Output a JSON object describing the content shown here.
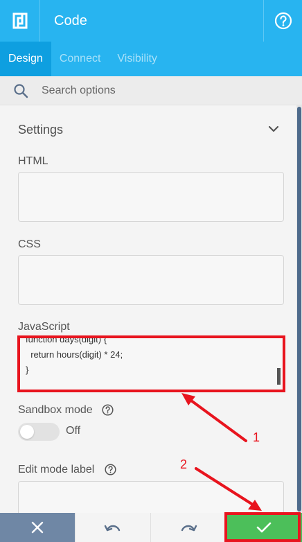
{
  "header": {
    "title": "Code"
  },
  "tabs": [
    {
      "label": "Design",
      "active": true
    },
    {
      "label": "Connect",
      "active": false
    },
    {
      "label": "Visibility",
      "active": false
    }
  ],
  "search": {
    "placeholder": "Search options"
  },
  "settings": {
    "title": "Settings",
    "html_label": "HTML",
    "html_value": "",
    "css_label": "CSS",
    "css_value": "",
    "js_label": "JavaScript",
    "js_lines": [
      "function days(digit) {",
      "  return hours(digit) * 24;",
      "}"
    ],
    "sandbox_label": "Sandbox mode",
    "sandbox_state": "Off",
    "edit_mode_label": "Edit mode label",
    "edit_mode_value": ""
  },
  "annotations": {
    "one": "1",
    "two": "2"
  },
  "colors": {
    "accent": "#28b4f0",
    "accent_active": "#0e9fe0",
    "save": "#4cbf5a",
    "cancel": "#6f87a5",
    "annotation": "#e8141e"
  }
}
